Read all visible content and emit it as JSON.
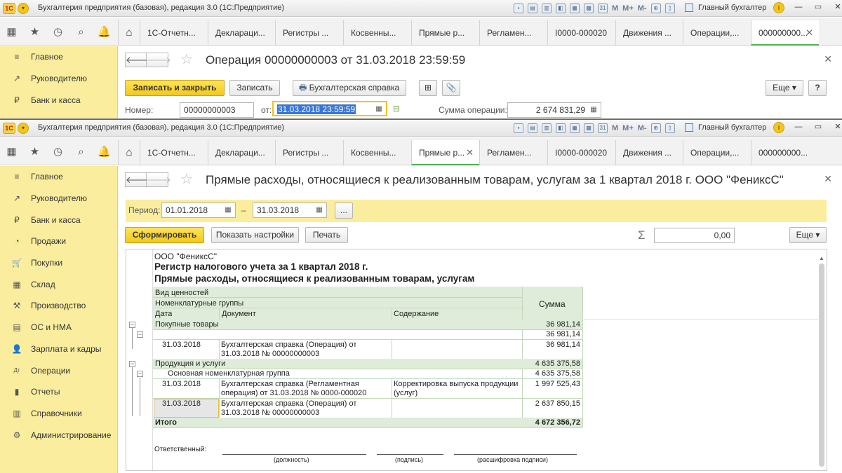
{
  "app": {
    "title": "Бухгалтерия предприятия (базовая), редакция 3.0  (1С:Предприятие)",
    "logo": "1С",
    "user": "Главный бухгалтер",
    "toolbar_icons": [
      "save-icon",
      "print-icon",
      "preview-icon",
      "compare-icon",
      "calendar-icon",
      "calc-icon",
      "calendar31-icon",
      "M",
      "M+",
      "M-",
      "zoom-icon",
      "panel-icon"
    ]
  },
  "tabs": [
    "1С-Отчетн...",
    "Деклараци...",
    "Регистры ...",
    "Косвенны...",
    "Прямые р...",
    "Регламен...",
    "I0000-000020",
    "Движения ...",
    "Операции,...",
    "000000000..."
  ],
  "sidebar": [
    {
      "icon": "≡",
      "label": "Главное"
    },
    {
      "icon": "↗",
      "label": "Руководителю"
    },
    {
      "icon": "₽",
      "label": "Банк и касса"
    },
    {
      "icon": "◔",
      "label": "Продажи"
    },
    {
      "icon": "🛒",
      "label": "Покупки"
    },
    {
      "icon": "▦",
      "label": "Склад"
    },
    {
      "icon": "⚒",
      "label": "Производство"
    },
    {
      "icon": "▤",
      "label": "ОС и НМА"
    },
    {
      "icon": "👤",
      "label": "Зарплата и кадры"
    },
    {
      "icon": "Дт",
      "label": "Операции"
    },
    {
      "icon": "▮",
      "label": "Отчеты"
    },
    {
      "icon": "▥",
      "label": "Справочники"
    },
    {
      "icon": "⚙",
      "label": "Администрирование"
    }
  ],
  "window1": {
    "active_tab": 9,
    "title": "Операция 00000000003 от 31.03.2018 23:59:59",
    "buttons": {
      "save_close": "Записать и закрыть",
      "save": "Записать",
      "reference": "Бухгалтерская справка",
      "more": "Еще",
      "help": "?"
    },
    "fields": {
      "number_label": "Номер:",
      "number": "00000000003",
      "date_label": "от:",
      "date": "31.03.2018 23:59:59",
      "sum_label": "Сумма операции:",
      "sum": "2 674 831,29"
    }
  },
  "window2": {
    "active_tab": 4,
    "title": "Прямые расходы, относящиеся к реализованным товарам, услугам за 1 квартал 2018 г. ООО \"ФениксС\"",
    "period": {
      "label": "Период:",
      "from": "01.01.2018",
      "dash": "–",
      "to": "31.03.2018",
      "more": "..."
    },
    "buttons": {
      "generate": "Сформировать",
      "settings": "Показать настройки",
      "print": "Печать",
      "more": "Еще"
    },
    "sigma_value": "0,00",
    "report": {
      "org": "ООО \"ФениксС\"",
      "heading1": "Регистр налогового учета за 1 квартал 2018 г.",
      "heading2": "Прямые расходы, относящиеся к реализованным товарам, услугам",
      "headers": {
        "h1": "Вид ценностей",
        "h2": "Номенклатурные группы",
        "date": "Дата",
        "document": "Документ",
        "content": "Содержание",
        "sum": "Сумма"
      },
      "groups": [
        {
          "name": "Покупные товары",
          "sum": "36 981,14",
          "subgroup_sum": "36 981,14",
          "rows": [
            {
              "date": "31.03.2018",
              "doc1": "Бухгалтерская справка (Операция) от",
              "doc2": "31.03.2018 № 00000000003",
              "content1": "",
              "content2": "",
              "sum": "36 981,14"
            }
          ]
        },
        {
          "name": "Продукция и услуги",
          "sum": "4 635 375,58",
          "subgroup": "Основная номенклатурная группа",
          "subgroup_sum": "4 635 375,58",
          "rows": [
            {
              "date": "31.03.2018",
              "doc1": "Бухгалтерская справка (Регламентная",
              "doc2": "операция) от 31.03.2018 № 0000-000020",
              "content1": "Корректировка выпуска продукции",
              "content2": "(услуг)",
              "sum": "1 997 525,43"
            },
            {
              "date": "31.03.2018",
              "doc1": "Бухгалтерская справка (Операция) от",
              "doc2": "31.03.2018 № 00000000003",
              "content1": "",
              "content2": "",
              "sum": "2 637 850,15"
            }
          ]
        }
      ],
      "total_label": "Итого",
      "total": "4 672 356,72",
      "signature": {
        "label": "Ответственный:",
        "position": "(должность)",
        "sign": "(подпись)",
        "decode": "(расшифровка подписи)"
      }
    }
  }
}
